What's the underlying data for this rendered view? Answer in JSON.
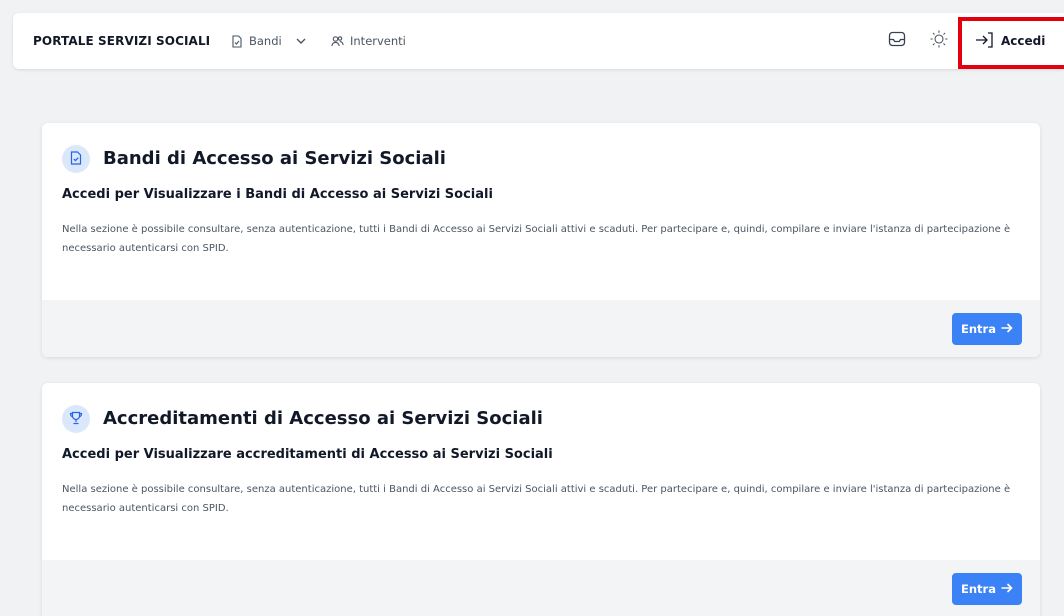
{
  "header": {
    "brand": "PORTALE SERVIZI SOCIALI",
    "nav": [
      {
        "label": "Bandi",
        "icon": "document-icon",
        "has_dropdown": true
      },
      {
        "label": "Interventi",
        "icon": "users-icon",
        "has_dropdown": false
      }
    ],
    "login_label": "Accedi",
    "highlight_color": "#e3000f"
  },
  "cards": [
    {
      "icon": "document-icon",
      "title": "Bandi di Accesso ai Servizi Sociali",
      "subtitle": "Accedi per Visualizzare i Bandi di Accesso ai Servizi Sociali",
      "description": "Nella sezione è possibile consultare, senza autenticazione, tutti i Bandi di Accesso ai Servizi Sociali attivi e scaduti. Per partecipare e, quindi, compilare e inviare l'istanza di partecipazione è necessario autenticarsi con SPID.",
      "button_label": "Entra"
    },
    {
      "icon": "trophy-icon",
      "title": "Accreditamenti di Accesso ai Servizi Sociali",
      "subtitle": "Accedi per Visualizzare accreditamenti di Accesso ai Servizi Sociali",
      "description": "Nella sezione è possibile consultare, senza autenticazione, tutti i Bandi di Accesso ai Servizi Sociali attivi e scaduti. Per partecipare e, quindi, compilare e inviare l'istanza di partecipazione è necessario autenticarsi con SPID.",
      "button_label": "Entra"
    }
  ],
  "colors": {
    "accent": "#3b82f6",
    "icon_bg": "#dbe7fb",
    "page_bg": "#f1f2f4"
  }
}
